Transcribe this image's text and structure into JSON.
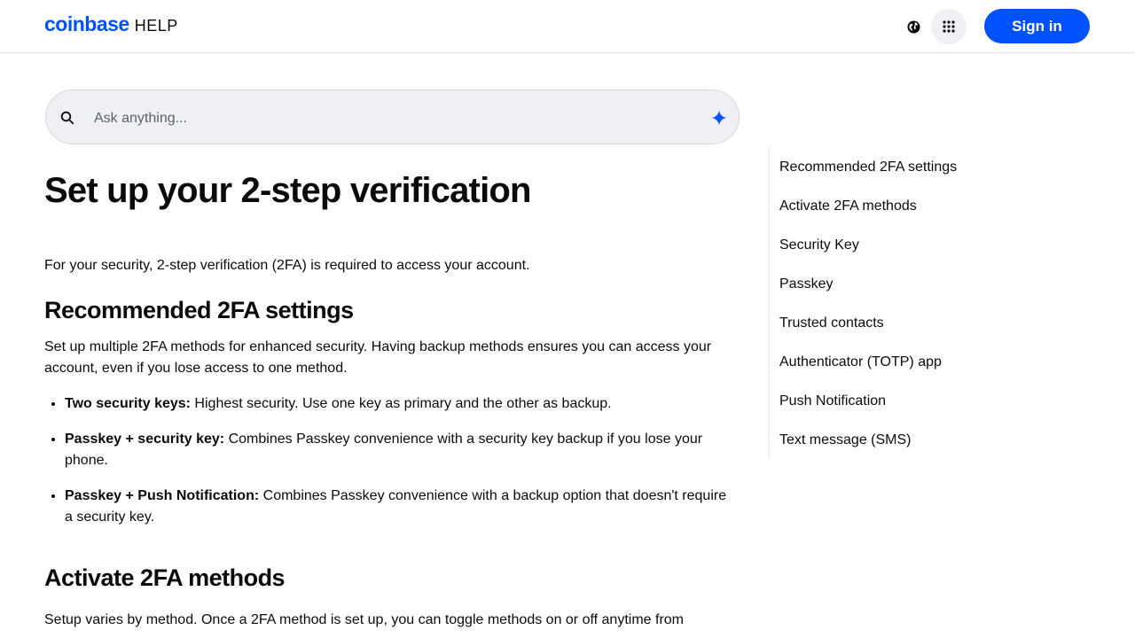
{
  "header": {
    "brand_logo": "coinbase",
    "brand_suffix": "HELP",
    "globe_icon": "globe-icon",
    "apps_icon": "grid-dots-icon",
    "signin_label": "Sign in"
  },
  "search": {
    "placeholder": "Ask anything...",
    "icon": "search-icon",
    "ai_icon": "sparkle-icon"
  },
  "article": {
    "title": "Set up your 2-step verification",
    "intro": "For your security, 2-step verification (2FA) is required to access your account.",
    "section1": {
      "heading": "Recommended 2FA settings",
      "paragraph": "Set up multiple 2FA methods for enhanced security. Having backup methods ensures you can access your account, even if you lose access to one method.",
      "bullets": [
        {
          "term": "Two security keys:",
          "text": " Highest security. Use one key as primary and the other as backup."
        },
        {
          "term": "Passkey + security key:",
          "text": " Combines Passkey convenience with a security key backup if you lose your phone."
        },
        {
          "term": "Passkey + Push Notification:",
          "text": " Combines Passkey convenience with a backup option that doesn't require a security key."
        }
      ]
    },
    "section2": {
      "heading": "Activate 2FA methods",
      "paragraph": "Setup varies by method. Once a 2FA method is set up, you can toggle methods on or off anytime from"
    }
  },
  "toc": {
    "items": [
      "Recommended 2FA settings",
      "Activate 2FA methods",
      "Security Key",
      "Passkey",
      "Trusted contacts",
      "Authenticator (TOTP) app",
      "Push Notification",
      "Text message (SMS)"
    ]
  },
  "colors": {
    "brand_blue": "#0052ff",
    "search_bg": "#eef0f3",
    "text": "#0a0b0d"
  }
}
